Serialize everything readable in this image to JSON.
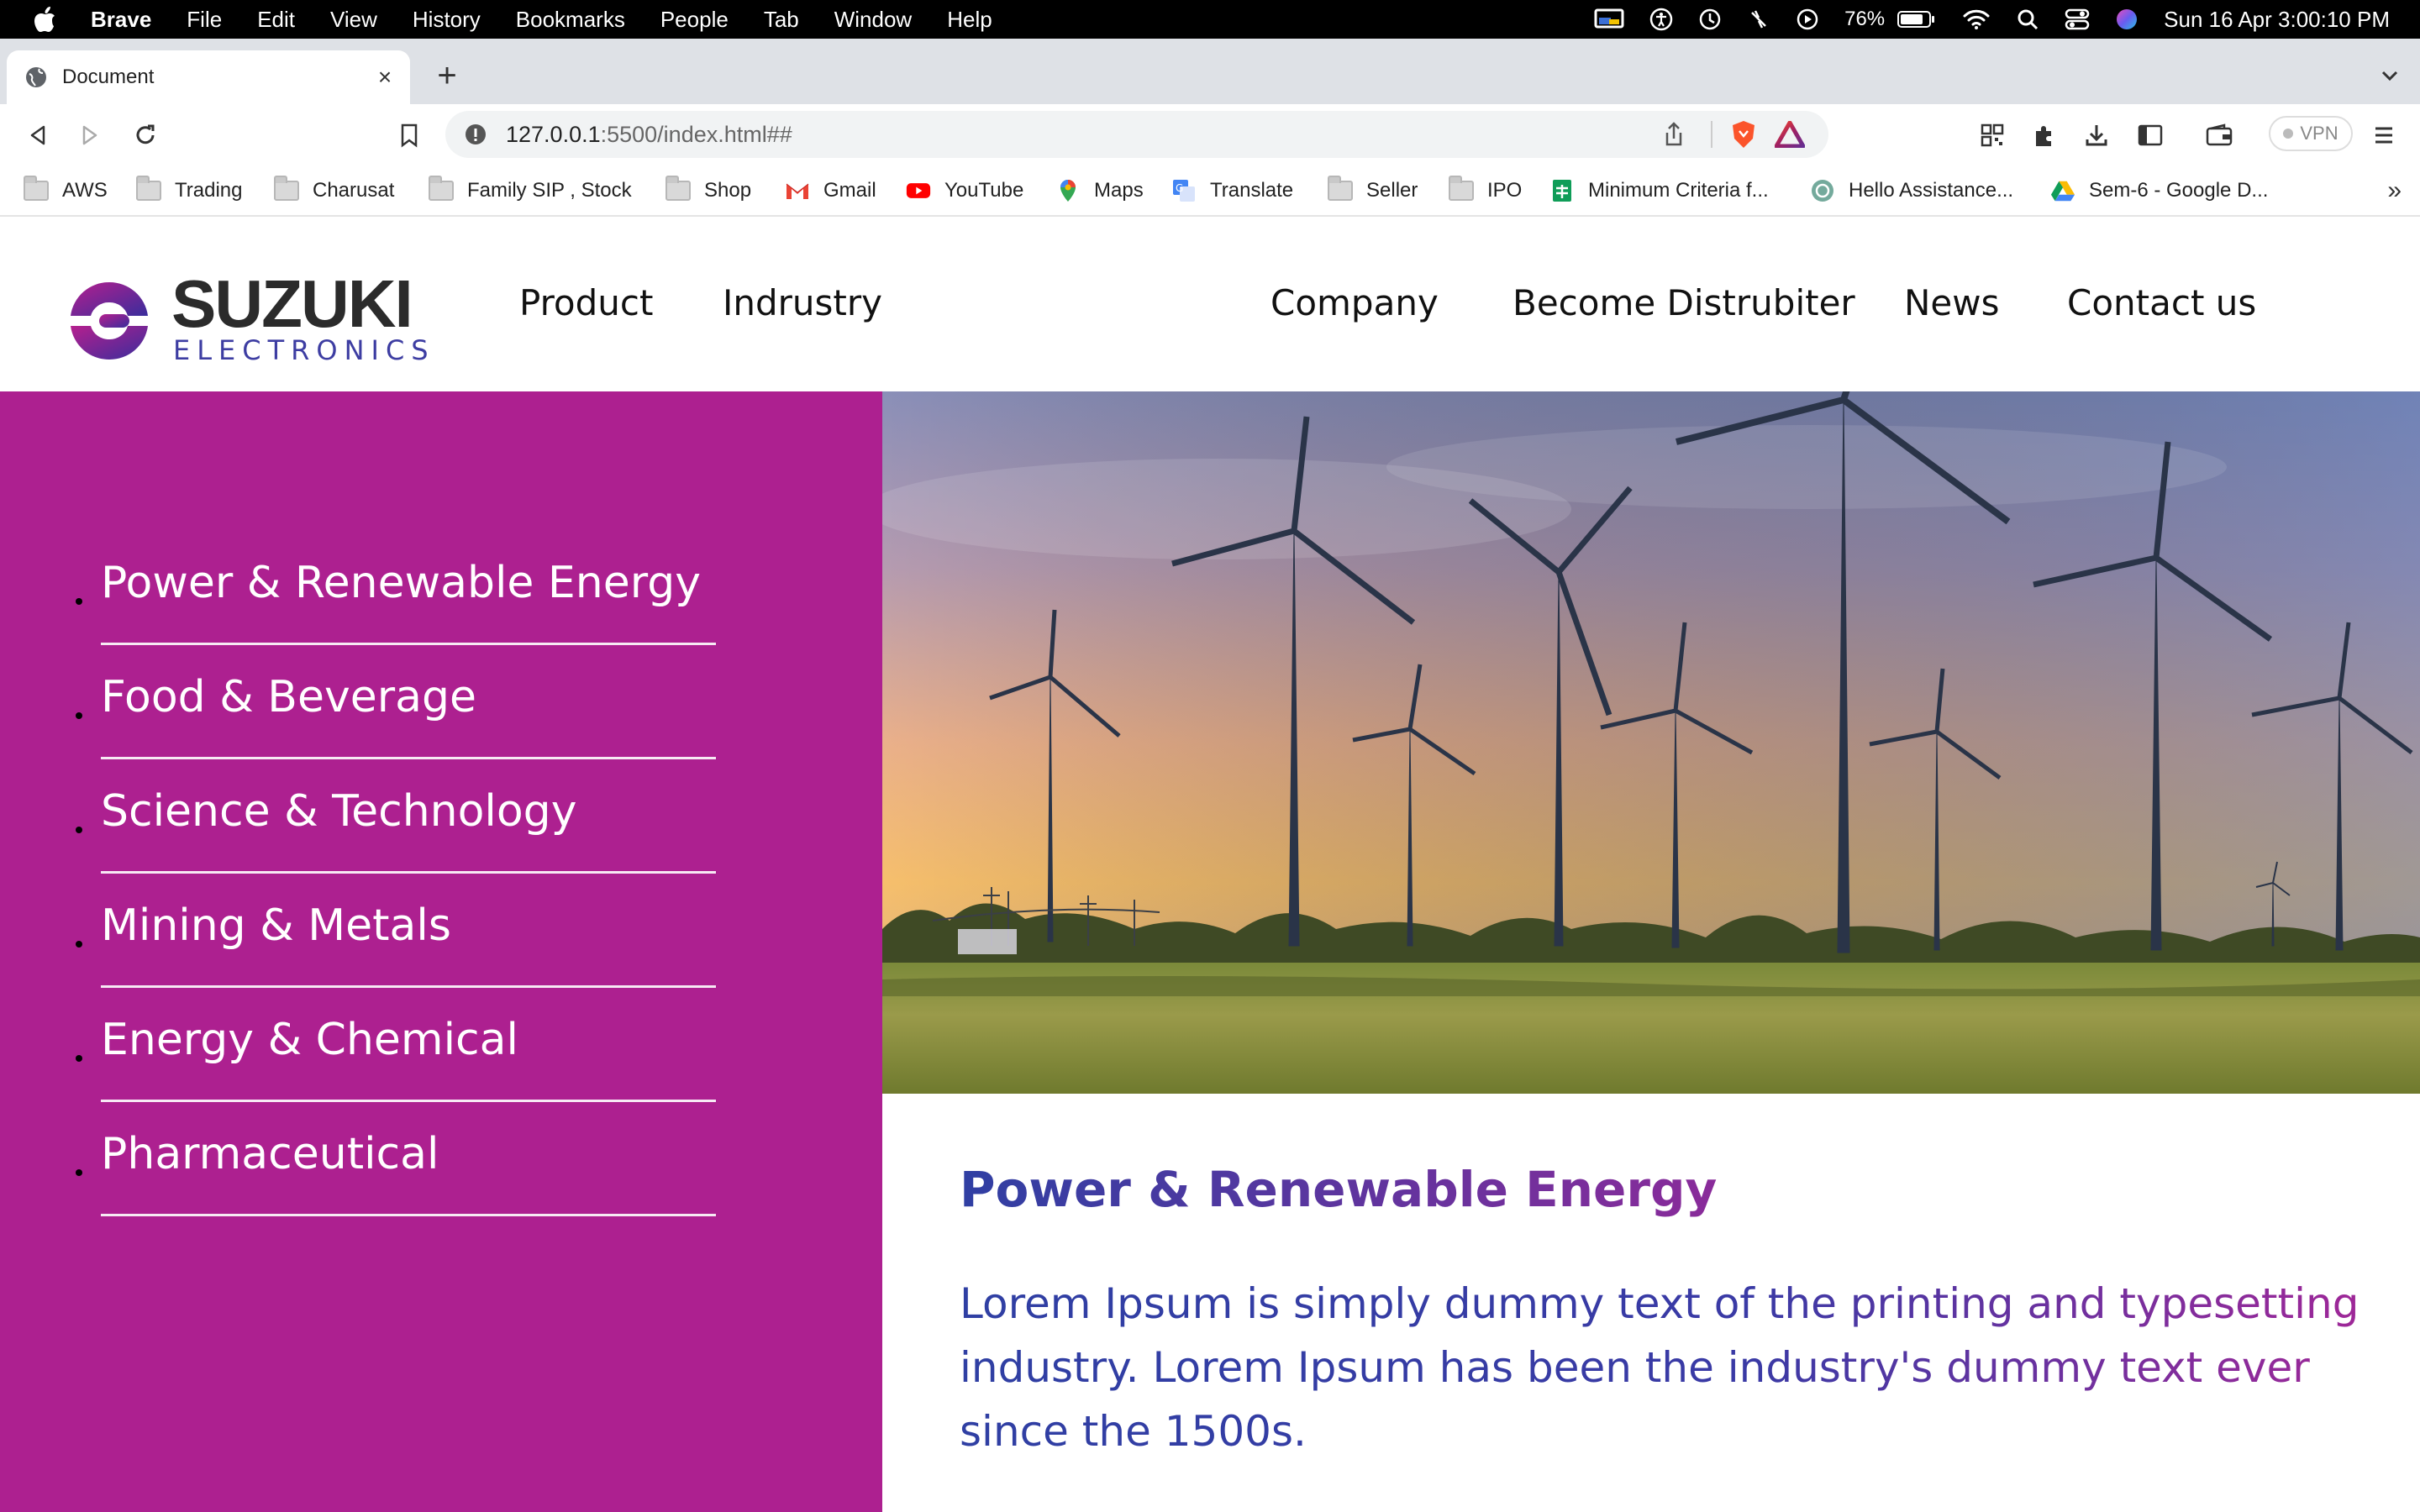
{
  "menubar": {
    "app_name": "Brave",
    "items": [
      "File",
      "Edit",
      "View",
      "History",
      "Bookmarks",
      "People",
      "Tab",
      "Window",
      "Help"
    ],
    "battery": "76%",
    "datetime": "Sun 16 Apr  3:00:10 PM"
  },
  "browser": {
    "tab_title": "Document",
    "url_host": "127.0.0.1",
    "url_path": ":5500/index.html##",
    "vpn_label": "VPN",
    "bookmarks": [
      {
        "label": "AWS",
        "icon": "folder-icon"
      },
      {
        "label": "Trading",
        "icon": "folder-icon"
      },
      {
        "label": "Charusat",
        "icon": "folder-icon"
      },
      {
        "label": "Family SIP , Stock",
        "icon": "folder-icon"
      },
      {
        "label": "Shop",
        "icon": "folder-icon"
      },
      {
        "label": "Gmail",
        "icon": "gmail-icon"
      },
      {
        "label": "YouTube",
        "icon": "youtube-icon"
      },
      {
        "label": "Maps",
        "icon": "maps-icon"
      },
      {
        "label": "Translate",
        "icon": "translate-icon"
      },
      {
        "label": "Seller",
        "icon": "folder-icon"
      },
      {
        "label": "IPO",
        "icon": "folder-icon"
      },
      {
        "label": "Minimum Criteria f...",
        "icon": "sheets-icon"
      },
      {
        "label": "Hello Assistance...",
        "icon": "chatgpt-icon"
      },
      {
        "label": "Sem-6 - Google D...",
        "icon": "drive-icon"
      }
    ]
  },
  "site": {
    "logo_main": "SUZUKI",
    "logo_sub": "ELECTRONICS",
    "nav": [
      "Product",
      "Indrustry",
      "Company",
      "Become Distrubiter",
      "News",
      "Contact us"
    ],
    "sidebar_items": [
      "Power & Renewable Energy",
      "Food & Beverage",
      "Science & Technology",
      "Mining & Metals",
      "Energy & Chemical",
      "Pharmaceutical"
    ],
    "content_title": "Power & Renewable Energy",
    "content_text": "Lorem Ipsum is simply dummy text of the printing and typesetting industry. Lorem Ipsum has been the industry's dummy text ever since the 1500s.",
    "colors": {
      "sidebar": "#ad2090",
      "title_start": "#2f3fa3",
      "title_end": "#8a2b9a"
    }
  }
}
